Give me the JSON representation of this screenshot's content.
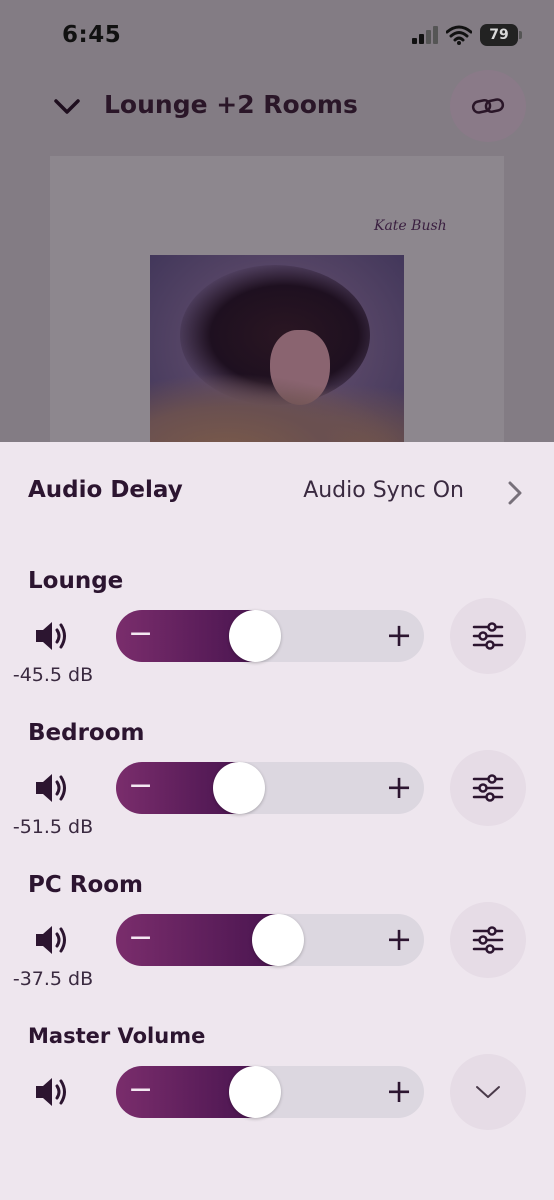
{
  "status_bar": {
    "time": "6:45",
    "battery": "79"
  },
  "header": {
    "title": "Lounge +2 Rooms"
  },
  "album": {
    "artist": "Kate Bush"
  },
  "audio_delay": {
    "label": "Audio Delay",
    "value": "Audio Sync On"
  },
  "rooms": [
    {
      "name": "Lounge",
      "db": "-45.5 dB",
      "volume_fraction": 0.44
    },
    {
      "name": "Bedroom",
      "db": "-51.5 dB",
      "volume_fraction": 0.38
    },
    {
      "name": "PC Room",
      "db": "-37.5 dB",
      "volume_fraction": 0.53
    }
  ],
  "master": {
    "name": "Master Volume",
    "volume_fraction": 0.44
  },
  "slider": {
    "minus": "−",
    "plus": "+"
  },
  "icons": {
    "back": "chevron-down-icon",
    "group": "link-icon",
    "speaker": "speaker-icon",
    "eq": "equalizer-icon",
    "expand": "chevron-down-icon",
    "next": "chevron-right-icon"
  },
  "colors": {
    "accent": "#5a1a5a",
    "text": "#2c1530",
    "sheet": "#eee6ee"
  }
}
